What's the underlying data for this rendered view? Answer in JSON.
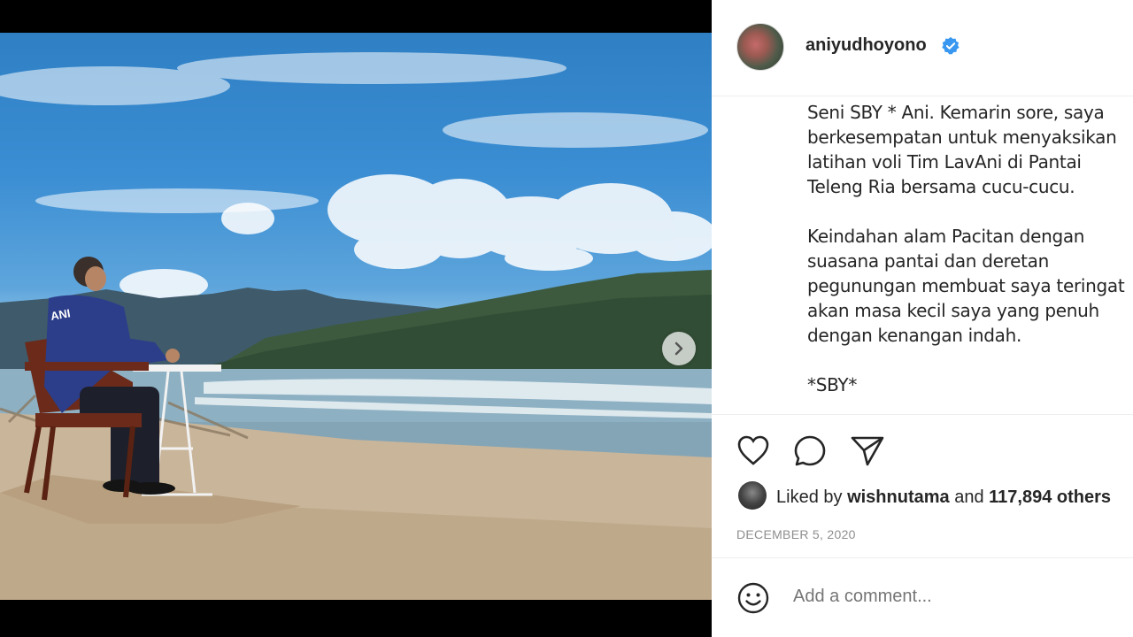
{
  "post": {
    "username": "aniyudhoyono",
    "caption": "Seni SBY * Ani. Kemarin sore, saya\nberkesempatan untuk menyaksikan\nlatihan voli Tim LavAni di Pantai\nTeleng Ria bersama cucu-cucu.\n\nKeindahan alam Pacitan dengan\nsuasana pantai dan deretan\npegunungan membuat saya teringat\nakan masa kecil saya yang penuh\ndengan kenangan indah.\n\n*SBY*",
    "liked_prefix": "Liked by ",
    "liked_user": "wishnutama",
    "liked_and": " and ",
    "liked_count": "117,894 others",
    "date": "DECEMBER 5, 2020",
    "comment_placeholder": "Add a comment...",
    "shirt_text": "ANI"
  },
  "icons": {
    "verified": "verified-badge-icon",
    "like": "heart-icon",
    "comment": "comment-bubble-icon",
    "share": "paper-plane-icon",
    "emoji": "smiley-icon",
    "next": "chevron-right-icon"
  },
  "carousel": {
    "total": 2,
    "active": 1
  },
  "colors": {
    "verified": "#3897f0",
    "text": "#262626",
    "muted": "#8e8e8e"
  }
}
